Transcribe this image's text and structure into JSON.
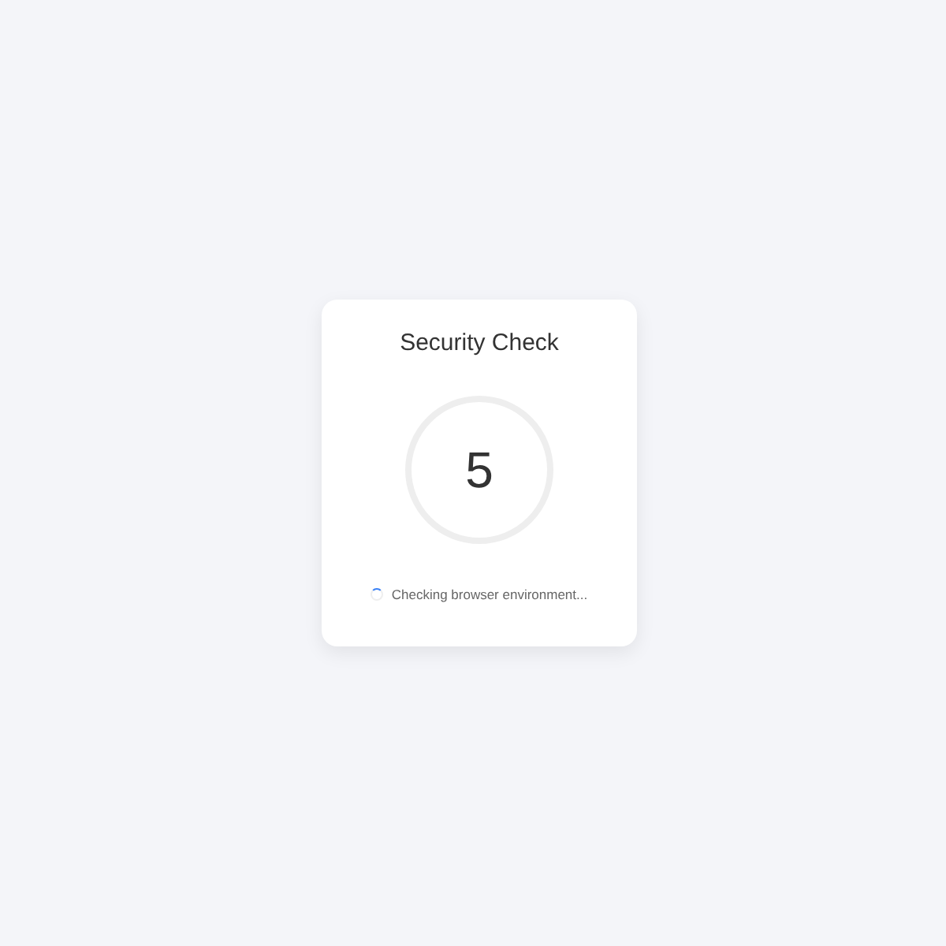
{
  "card": {
    "title": "Security Check",
    "countdown": "5",
    "status": "Checking browser environment..."
  }
}
